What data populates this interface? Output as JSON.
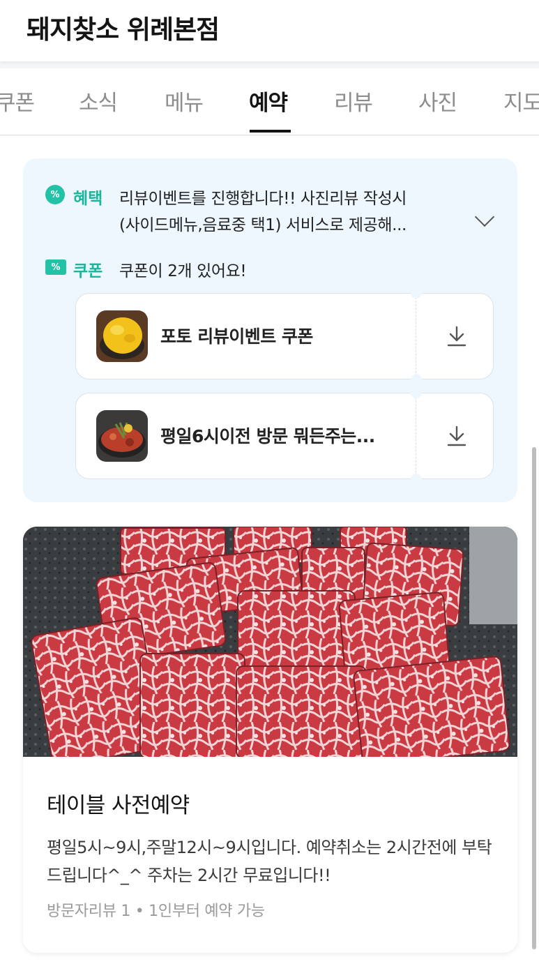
{
  "header": {
    "title": "돼지찾소 위례본점"
  },
  "tabs": [
    {
      "label": "쿠폰"
    },
    {
      "label": "소식"
    },
    {
      "label": "메뉴"
    },
    {
      "label": "예약"
    },
    {
      "label": "리뷰"
    },
    {
      "label": "사진"
    },
    {
      "label": "지도"
    }
  ],
  "active_tab": "예약",
  "benefits": {
    "benefit_label": "혜택",
    "benefit_line1": "리뷰이벤트를 진행합니다!! 사진리뷰 작성시",
    "benefit_line2": "(사이드메뉴,음료중 택1) 서비스로 제공해...",
    "coupon_label": "쿠폰",
    "coupon_summary": "쿠폰이 2개 있어요!",
    "coupons": [
      {
        "title": "포토 리뷰이벤트 쿠폰"
      },
      {
        "title": "평일6시이전 방문 뭐든주는..."
      }
    ]
  },
  "reservation": {
    "title": "테이블 사전예약",
    "description": "평일5시~9시,주말12시~9시입니다. 예약취소는 2시간전에 부탁드립니다^_^ 주차는 2시간 무료입니다!!",
    "meta": "방문자리뷰 1 • 1인부터 예약 가능"
  },
  "colors": {
    "accent": "#1ab59a",
    "benefit_bg": "#eef7fd"
  }
}
